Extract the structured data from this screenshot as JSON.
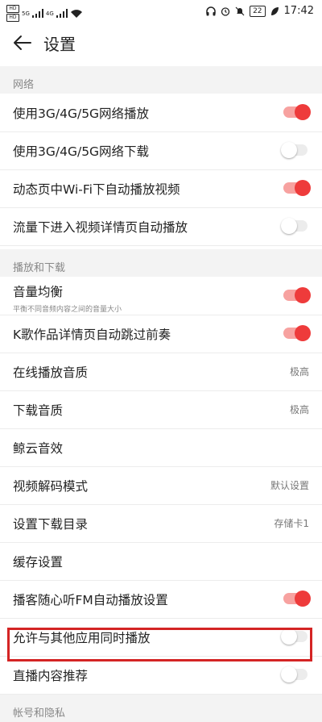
{
  "status_bar": {
    "hd1": "HD",
    "hd2": "HD",
    "net1": "5G",
    "net2": "4G",
    "battery": "22",
    "time": "17:42"
  },
  "header": {
    "title": "设置"
  },
  "sections": {
    "network": "网络",
    "playback": "播放和下载",
    "account": "帐号和隐私"
  },
  "rows": {
    "r1": {
      "label": "使用3G/4G/5G网络播放",
      "on": true
    },
    "r2": {
      "label": "使用3G/4G/5G网络下载",
      "on": false
    },
    "r3": {
      "label": "动态页中Wi-Fi下自动播放视频",
      "on": true
    },
    "r4": {
      "label": "流量下进入视频详情页自动播放",
      "on": false
    },
    "r5": {
      "label": "音量均衡",
      "sublabel": "平衡不同音频内容之间的音量大小",
      "on": true
    },
    "r6": {
      "label": "K歌作品详情页自动跳过前奏",
      "on": true
    },
    "r7": {
      "label": "在线播放音质",
      "value": "极高"
    },
    "r8": {
      "label": "下载音质",
      "value": "极高"
    },
    "r9": {
      "label": "鲸云音效"
    },
    "r10": {
      "label": "视频解码模式",
      "value": "默认设置"
    },
    "r11": {
      "label": "设置下载目录",
      "value": "存储卡1"
    },
    "r12": {
      "label": "缓存设置"
    },
    "r13": {
      "label": "播客随心听FM自动播放设置",
      "on": true
    },
    "r14": {
      "label": "允许与其他应用同时播放",
      "on": false
    },
    "r15": {
      "label": "直播内容推荐",
      "on": false
    }
  },
  "colors": {
    "accent": "#ee3b3b",
    "highlight_box": "#d42424"
  }
}
